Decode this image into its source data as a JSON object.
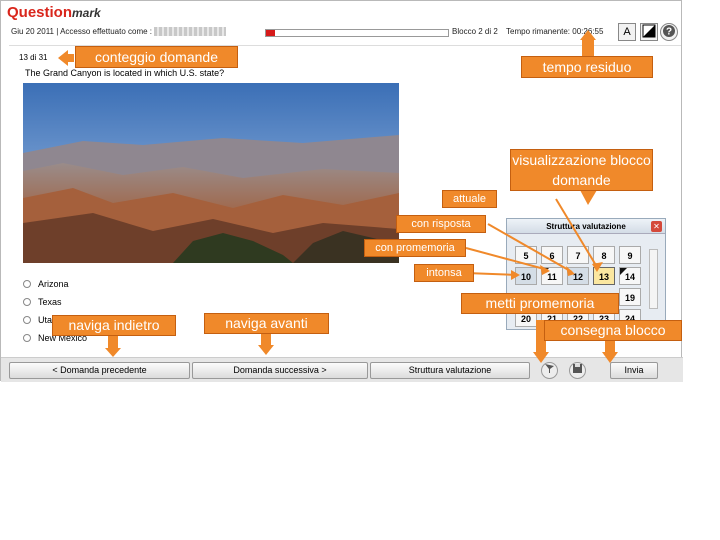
{
  "header": {
    "logo_main": "Question",
    "logo_sub": "mark",
    "date": "Giu 20 2011",
    "separator": "|",
    "login_label": "Accesso effettuato come :",
    "block": "Blocco 2 di 2",
    "time_label": "Tempo rimanente:",
    "time_value": "00:26:55",
    "progress_fraction": 0.05,
    "font_button": "A"
  },
  "question": {
    "count": "13 di 31",
    "text": "The Grand Canyon is located in which U.S. state?",
    "answers": [
      "Arizona",
      "Texas",
      "Utah",
      "New Mexico"
    ]
  },
  "nav": {
    "prev": "< Domanda precedente",
    "next": "Domanda successiva >",
    "structure": "Struttura valutazione",
    "submit": "Invia"
  },
  "panel": {
    "title": "Struttura valutazione",
    "cells": [
      "5",
      "6",
      "7",
      "8",
      "9",
      "10",
      "11",
      "12",
      "13",
      "14",
      "19",
      "20",
      "21",
      "22",
      "23",
      "24"
    ]
  },
  "callouts": {
    "count": "conteggio domande",
    "time": "tempo residuo",
    "block_view": "visualizzazione blocco domande",
    "current": "attuale",
    "answered": "con risposta",
    "reminder": "con promemoria",
    "untouched": "intonsa",
    "set_reminder": "metti promemoria",
    "submit_block": "consegna blocco",
    "back": "naviga indietro",
    "forward": "naviga avanti"
  },
  "colors": {
    "callout": "#f0892a",
    "brand": "#d9261c",
    "progress": "#d61a1a"
  }
}
